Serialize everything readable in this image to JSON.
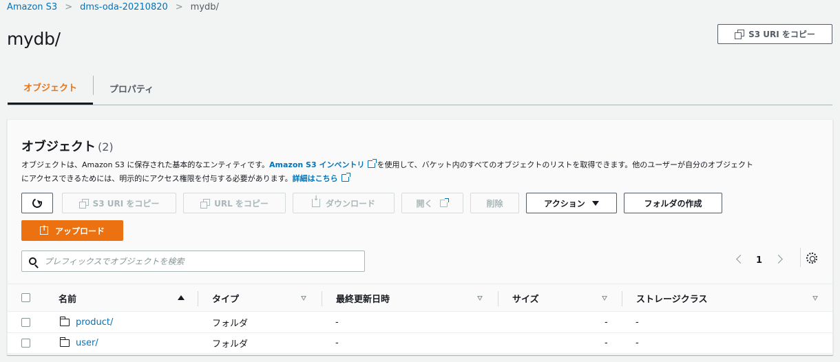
{
  "breadcrumb": {
    "items": [
      "Amazon S3",
      "dms-oda-20210820"
    ],
    "current": "mydb/"
  },
  "header": {
    "title": "mydb/",
    "copy_uri_label": "S3 URI をコピー"
  },
  "tabs": [
    {
      "label": "オブジェクト",
      "active": true
    },
    {
      "label": "プロパティ",
      "active": false
    }
  ],
  "panel": {
    "title": "オブジェクト",
    "count": "(2)",
    "description": {
      "part1": "オブジェクトは、Amazon S3 に保存された基本的なエンティティです。",
      "link1": "Amazon S3 インベントリ",
      "part2": "を使用して、バケット内のすべてのオブジェクトのリストを取得できます。他のユーザーが自分のオブジェクト",
      "part3": "にアクセスできるためには、明示的にアクセス権限を付与する必要があります。",
      "link2": "詳細はこちら"
    }
  },
  "toolbar": {
    "copy_s3_uri": "S3 URI をコピー",
    "copy_url": "URL をコピー",
    "download": "ダウンロード",
    "open": "開く",
    "delete": "削除",
    "actions": "アクション",
    "create_folder": "フォルダの作成",
    "upload": "アップロード"
  },
  "search": {
    "placeholder": "プレフィックスでオブジェクトを検索"
  },
  "pagination": {
    "page": "1"
  },
  "table": {
    "columns": [
      "名前",
      "タイプ",
      "最終更新日時",
      "サイズ",
      "ストレージクラス"
    ],
    "rows": [
      {
        "name": "product/",
        "type": "フォルダ",
        "modified": "-",
        "size": "-",
        "storage": "-"
      },
      {
        "name": "user/",
        "type": "フォルダ",
        "modified": "-",
        "size": "-",
        "storage": "-"
      }
    ]
  },
  "colors": {
    "accent": "#ec7211",
    "link": "#0073bb"
  }
}
